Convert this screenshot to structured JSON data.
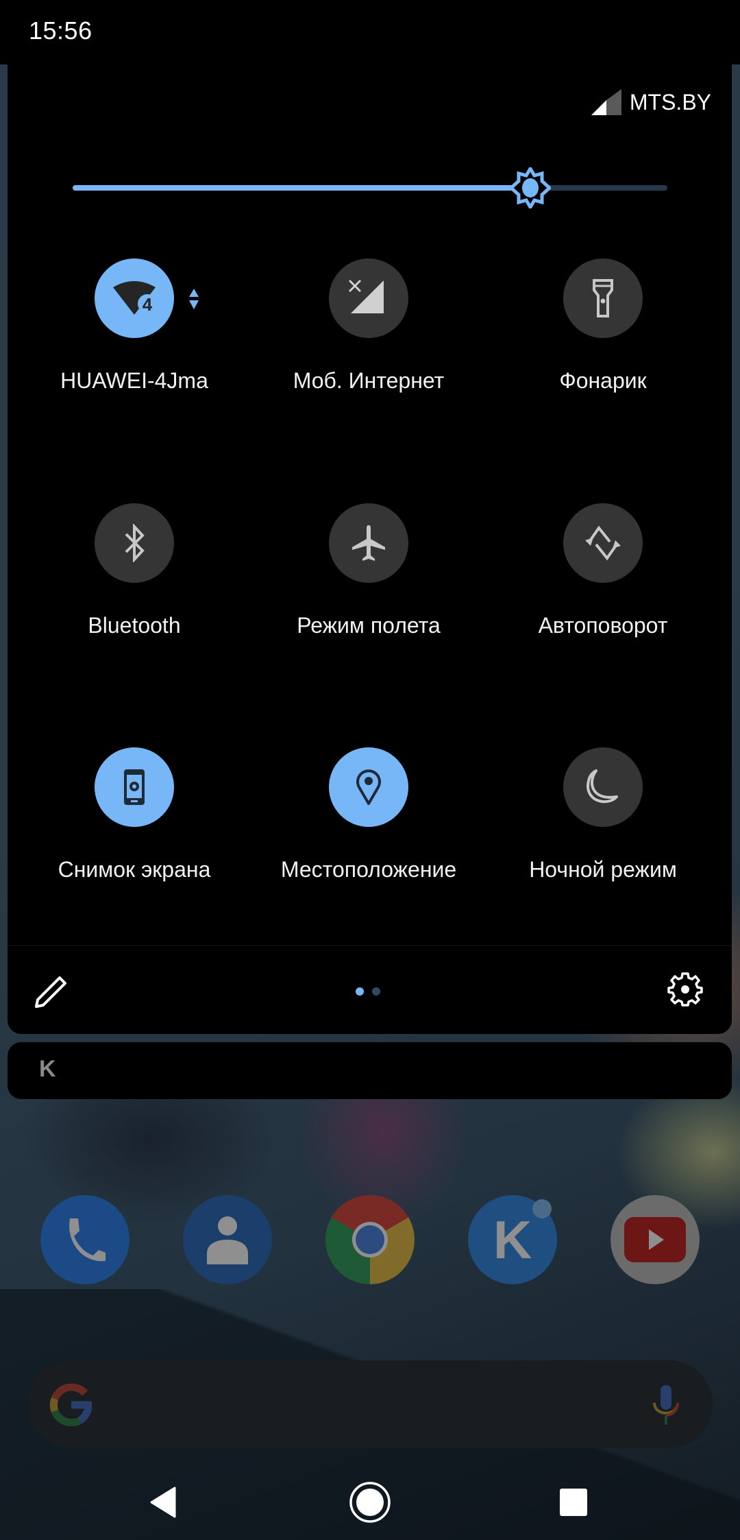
{
  "status_bar": {
    "time": "15:56"
  },
  "quick_settings": {
    "carrier": {
      "name": "MTS.BY",
      "icon": "cell-signal-icon"
    },
    "brightness": {
      "level_fraction": 0.77,
      "icon": "brightness-auto-icon",
      "fill_color": "#77b6f7",
      "track_color": "#26384c"
    },
    "tiles": [
      {
        "id": "wifi",
        "label": "HUAWEI-4Jma",
        "icon": "wifi-icon",
        "badge": "4",
        "active": true
      },
      {
        "id": "mobile-data",
        "label": "Моб. Интернет",
        "icon": "mobile-data-off-icon",
        "active": false
      },
      {
        "id": "flashlight",
        "label": "Фонарик",
        "icon": "flashlight-icon",
        "active": false
      },
      {
        "id": "bluetooth",
        "label": "Bluetooth",
        "icon": "bluetooth-icon",
        "active": false
      },
      {
        "id": "airplane",
        "label": "Режим полета",
        "icon": "airplane-icon",
        "active": false
      },
      {
        "id": "auto-rotate",
        "label": "Автоповорот",
        "icon": "auto-rotate-icon",
        "active": false
      },
      {
        "id": "screenshot",
        "label": "Снимок экрана",
        "icon": "screenshot-icon",
        "active": true
      },
      {
        "id": "location",
        "label": "Местоположение",
        "icon": "location-icon",
        "active": true
      },
      {
        "id": "night-mode",
        "label": "Ночной режим",
        "icon": "night-mode-icon",
        "active": false
      }
    ],
    "footer": {
      "edit_icon": "pencil-icon",
      "settings_icon": "gear-icon",
      "pages": {
        "current": 1,
        "total": 2
      }
    },
    "colors": {
      "active": "#77b6f7",
      "inactive": "#353535",
      "icon_inactive": "#c8c8c8",
      "icon_active": "#1f2a36"
    }
  },
  "notification": {
    "app_icon_letter": "K"
  },
  "dock": {
    "apps": [
      {
        "name": "Phone",
        "icon": "phone-icon"
      },
      {
        "name": "Contacts",
        "icon": "contacts-icon"
      },
      {
        "name": "Chrome",
        "icon": "chrome-icon"
      },
      {
        "name": "Kate Mobile",
        "icon": "k-app-icon",
        "letter": "K",
        "has_badge": true
      },
      {
        "name": "YouTube",
        "icon": "youtube-icon"
      }
    ]
  },
  "search_widget": {
    "left_icon": "google-g-icon",
    "right_icon": "microphone-icon"
  },
  "nav_bar": {
    "back": "back-icon",
    "home": "home-icon",
    "recents": "recents-icon"
  }
}
